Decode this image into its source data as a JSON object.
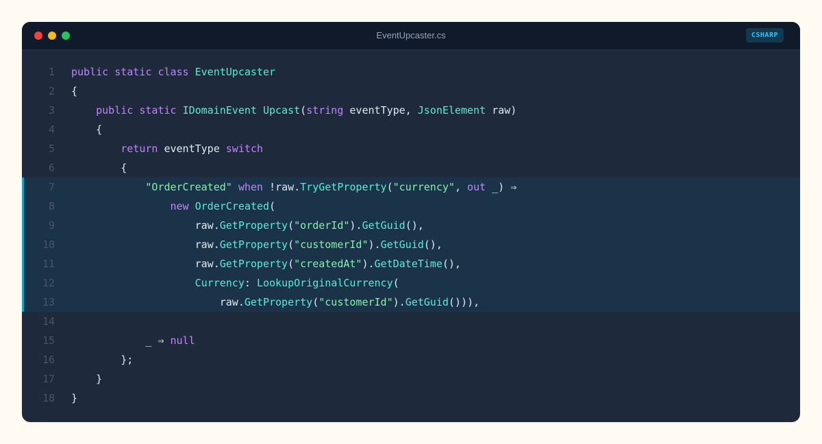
{
  "window": {
    "filename": "EventUpcaster.cs",
    "language_badge": "CSHARP"
  },
  "colors": {
    "background": "#fffbf3",
    "editor": "#1e293b",
    "titlebar": "#111a2b",
    "highlight": "#1b3349",
    "highlight_bar": "#0ea5c6",
    "keyword": "#c084fc",
    "type": "#5eead4",
    "string": "#86efac",
    "plain": "#e2e8f0",
    "line_number": "#475569"
  },
  "code": {
    "highlighted_lines": [
      7,
      8,
      9,
      10,
      11,
      12,
      13
    ],
    "lines": [
      {
        "n": "1",
        "indent": 0,
        "tokens": [
          {
            "t": "public",
            "c": "kw"
          },
          {
            "t": " ",
            "c": "pl"
          },
          {
            "t": "static",
            "c": "kw"
          },
          {
            "t": " ",
            "c": "pl"
          },
          {
            "t": "class",
            "c": "kw"
          },
          {
            "t": " ",
            "c": "pl"
          },
          {
            "t": "EventUpcaster",
            "c": "ty"
          }
        ]
      },
      {
        "n": "2",
        "indent": 0,
        "tokens": [
          {
            "t": "{",
            "c": "pl"
          }
        ]
      },
      {
        "n": "3",
        "indent": 4,
        "tokens": [
          {
            "t": "public",
            "c": "kw"
          },
          {
            "t": " ",
            "c": "pl"
          },
          {
            "t": "static",
            "c": "kw"
          },
          {
            "t": " ",
            "c": "pl"
          },
          {
            "t": "IDomainEvent",
            "c": "ty"
          },
          {
            "t": " ",
            "c": "pl"
          },
          {
            "t": "Upcast",
            "c": "fn"
          },
          {
            "t": "(",
            "c": "pl"
          },
          {
            "t": "string",
            "c": "kw"
          },
          {
            "t": " eventType, ",
            "c": "pl"
          },
          {
            "t": "JsonElement",
            "c": "ty"
          },
          {
            "t": " raw)",
            "c": "pl"
          }
        ]
      },
      {
        "n": "4",
        "indent": 4,
        "tokens": [
          {
            "t": "{",
            "c": "pl"
          }
        ]
      },
      {
        "n": "5",
        "indent": 8,
        "tokens": [
          {
            "t": "return",
            "c": "kw"
          },
          {
            "t": " eventType ",
            "c": "pl"
          },
          {
            "t": "switch",
            "c": "kw"
          }
        ]
      },
      {
        "n": "6",
        "indent": 8,
        "tokens": [
          {
            "t": "{",
            "c": "pl"
          }
        ]
      },
      {
        "n": "7",
        "indent": 12,
        "tokens": [
          {
            "t": "\"OrderCreated\"",
            "c": "str"
          },
          {
            "t": " ",
            "c": "pl"
          },
          {
            "t": "when",
            "c": "kw"
          },
          {
            "t": " !raw.",
            "c": "pl"
          },
          {
            "t": "TryGetProperty",
            "c": "fn"
          },
          {
            "t": "(",
            "c": "pl"
          },
          {
            "t": "\"currency\"",
            "c": "str"
          },
          {
            "t": ", ",
            "c": "pl"
          },
          {
            "t": "out",
            "c": "kw"
          },
          {
            "t": " _) ⇒",
            "c": "pl"
          }
        ]
      },
      {
        "n": "8",
        "indent": 16,
        "tokens": [
          {
            "t": "new",
            "c": "kw"
          },
          {
            "t": " ",
            "c": "pl"
          },
          {
            "t": "OrderCreated",
            "c": "ty"
          },
          {
            "t": "(",
            "c": "pl"
          }
        ]
      },
      {
        "n": "9",
        "indent": 20,
        "tokens": [
          {
            "t": "raw.",
            "c": "pl"
          },
          {
            "t": "GetProperty",
            "c": "fn"
          },
          {
            "t": "(",
            "c": "pl"
          },
          {
            "t": "\"orderId\"",
            "c": "str"
          },
          {
            "t": ").",
            "c": "pl"
          },
          {
            "t": "GetGuid",
            "c": "fn"
          },
          {
            "t": "(),",
            "c": "pl"
          }
        ]
      },
      {
        "n": "10",
        "indent": 20,
        "tokens": [
          {
            "t": "raw.",
            "c": "pl"
          },
          {
            "t": "GetProperty",
            "c": "fn"
          },
          {
            "t": "(",
            "c": "pl"
          },
          {
            "t": "\"customerId\"",
            "c": "str"
          },
          {
            "t": ").",
            "c": "pl"
          },
          {
            "t": "GetGuid",
            "c": "fn"
          },
          {
            "t": "(),",
            "c": "pl"
          }
        ]
      },
      {
        "n": "11",
        "indent": 20,
        "tokens": [
          {
            "t": "raw.",
            "c": "pl"
          },
          {
            "t": "GetProperty",
            "c": "fn"
          },
          {
            "t": "(",
            "c": "pl"
          },
          {
            "t": "\"createdAt\"",
            "c": "str"
          },
          {
            "t": ").",
            "c": "pl"
          },
          {
            "t": "GetDateTime",
            "c": "fn"
          },
          {
            "t": "(),",
            "c": "pl"
          }
        ]
      },
      {
        "n": "12",
        "indent": 20,
        "tokens": [
          {
            "t": "Currency",
            "c": "ty"
          },
          {
            "t": ": ",
            "c": "pl"
          },
          {
            "t": "LookupOriginalCurrency",
            "c": "fn"
          },
          {
            "t": "(",
            "c": "pl"
          }
        ]
      },
      {
        "n": "13",
        "indent": 24,
        "tokens": [
          {
            "t": "raw.",
            "c": "pl"
          },
          {
            "t": "GetProperty",
            "c": "fn"
          },
          {
            "t": "(",
            "c": "pl"
          },
          {
            "t": "\"customerId\"",
            "c": "str"
          },
          {
            "t": ").",
            "c": "pl"
          },
          {
            "t": "GetGuid",
            "c": "fn"
          },
          {
            "t": "())),",
            "c": "pl"
          }
        ]
      },
      {
        "n": "14",
        "indent": 0,
        "tokens": []
      },
      {
        "n": "15",
        "indent": 12,
        "tokens": [
          {
            "t": "_ ⇒ ",
            "c": "pl"
          },
          {
            "t": "null",
            "c": "kw"
          }
        ]
      },
      {
        "n": "16",
        "indent": 8,
        "tokens": [
          {
            "t": "};",
            "c": "pl"
          }
        ]
      },
      {
        "n": "17",
        "indent": 4,
        "tokens": [
          {
            "t": "}",
            "c": "pl"
          }
        ]
      },
      {
        "n": "18",
        "indent": 0,
        "tokens": [
          {
            "t": "}",
            "c": "pl"
          }
        ]
      }
    ]
  }
}
